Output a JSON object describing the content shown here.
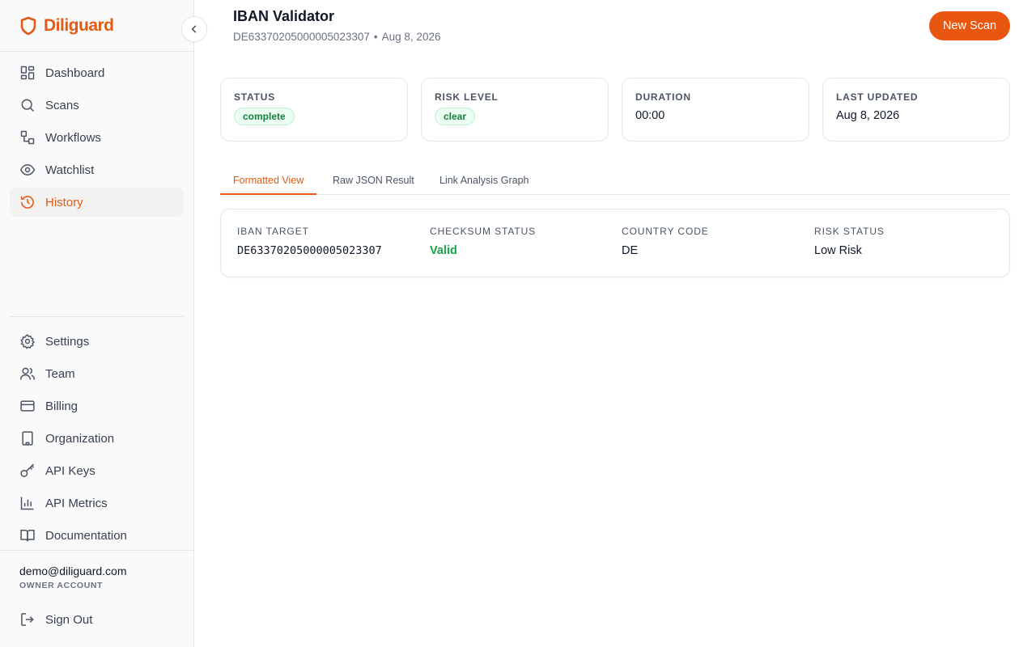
{
  "brand": {
    "name": "Diliguard",
    "accent": "#e35a12"
  },
  "nav": {
    "primary": [
      {
        "id": "dashboard",
        "label": "Dashboard",
        "icon": "grid-icon"
      },
      {
        "id": "scans",
        "label": "Scans",
        "icon": "search-icon"
      },
      {
        "id": "workflows",
        "label": "Workflows",
        "icon": "workflow-icon"
      },
      {
        "id": "watchlist",
        "label": "Watchlist",
        "icon": "eye-icon"
      },
      {
        "id": "history",
        "label": "History",
        "icon": "history-icon",
        "active": true
      }
    ],
    "secondary": [
      {
        "id": "settings",
        "label": "Settings",
        "icon": "gear-icon"
      },
      {
        "id": "team",
        "label": "Team",
        "icon": "users-icon"
      },
      {
        "id": "billing",
        "label": "Billing",
        "icon": "credit-card-icon"
      },
      {
        "id": "organization",
        "label": "Organization",
        "icon": "building-icon"
      },
      {
        "id": "api-keys",
        "label": "API Keys",
        "icon": "key-icon"
      },
      {
        "id": "api-metrics",
        "label": "API Metrics",
        "icon": "bar-chart-icon"
      },
      {
        "id": "documentation",
        "label": "Documentation",
        "icon": "book-icon"
      }
    ]
  },
  "account": {
    "email": "demo@diliguard.com",
    "role": "OWNER ACCOUNT",
    "sign_out": "Sign Out"
  },
  "header": {
    "title": "IBAN Validator",
    "iban": "DE63370205000005023307",
    "separator": "•",
    "date": "Aug 8, 2026",
    "new_scan": "New Scan"
  },
  "stats": {
    "status": {
      "label": "STATUS",
      "value": "complete"
    },
    "risk": {
      "label": "RISK LEVEL",
      "value": "clear"
    },
    "duration": {
      "label": "DURATION",
      "value": "00:00"
    },
    "updated": {
      "label": "LAST UPDATED",
      "value": "Aug 8, 2026"
    }
  },
  "tabs": [
    "Formatted View",
    "Raw JSON Result",
    "Link Analysis Graph"
  ],
  "result": {
    "iban": {
      "label": "IBAN TARGET",
      "value": "DE63370205000005023307"
    },
    "checksum": {
      "label": "CHECKSUM STATUS",
      "value": "Valid"
    },
    "country": {
      "label": "COUNTRY CODE",
      "value": "DE"
    },
    "risk": {
      "label": "RISK STATUS",
      "value": "Low Risk"
    }
  },
  "colors": {
    "primary_button": "#e8560f",
    "success": "#16a34a",
    "border": "#e5e7eb"
  }
}
